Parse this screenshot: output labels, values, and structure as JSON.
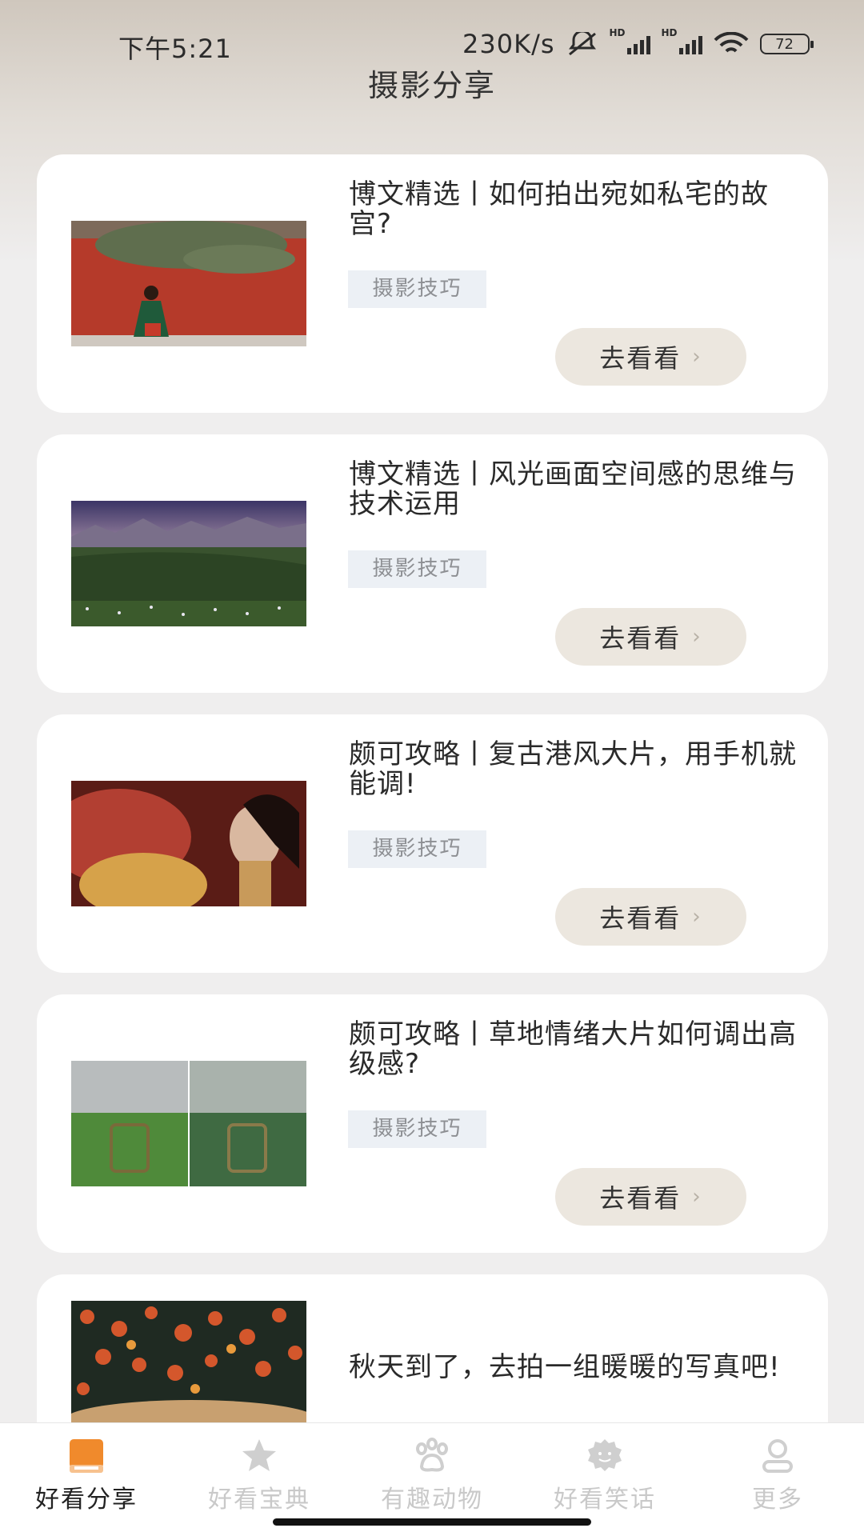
{
  "status_bar": {
    "time": "下午5:21",
    "net_speed": "230K/s",
    "battery": "72",
    "icons": [
      "mute-icon",
      "hd-signal-icon",
      "hd-signal-icon",
      "wifi-icon",
      "battery-icon"
    ]
  },
  "header": {
    "title": "摄影分享"
  },
  "articles": [
    {
      "title": "博文精选丨如何拍出宛如私宅的故宫?",
      "tag": "摄影技巧",
      "button": "去看看"
    },
    {
      "title": "博文精选丨风光画面空间感的思维与技术运用",
      "tag": "摄影技巧",
      "button": "去看看"
    },
    {
      "title": "颇可攻略丨复古港风大片，用手机就能调!",
      "tag": "摄影技巧",
      "button": "去看看"
    },
    {
      "title": "颇可攻略丨草地情绪大片如何调出高级感?",
      "tag": "摄影技巧",
      "button": "去看看"
    },
    {
      "title": "秋天到了，去拍一组暖暖的写真吧!"
    }
  ],
  "tabbar": {
    "tabs": [
      {
        "label": "好看分享",
        "icon": "book-icon",
        "active": true
      },
      {
        "label": "好看宝典",
        "icon": "star-icon",
        "active": false
      },
      {
        "label": "有趣动物",
        "icon": "paw-icon",
        "active": false
      },
      {
        "label": "好看笑话",
        "icon": "smile-badge-icon",
        "active": false
      },
      {
        "label": "更多",
        "icon": "person-icon",
        "active": false
      }
    ]
  },
  "colors": {
    "accent": "#f08a2c",
    "button_bg": "#ece7df",
    "tag_bg": "#ecf0f5"
  }
}
